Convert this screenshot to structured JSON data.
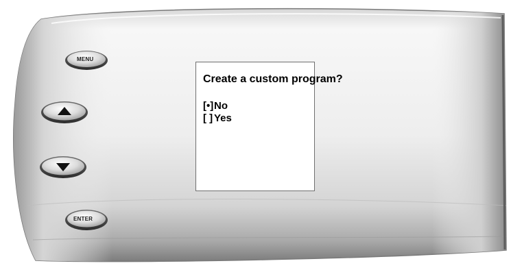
{
  "device": {
    "buttons": {
      "menu_label": "MENU",
      "enter_label": "ENTER",
      "up_icon": "triangle-up-icon",
      "down_icon": "triangle-down-icon"
    },
    "colors": {
      "body_light": "#f2f2f2",
      "body_mid": "#cfcfcf",
      "body_dark": "#8a8a8a",
      "screen_bg": "#ffffff",
      "screen_border": "#6f6f6f",
      "button_face": "#d9d9d9",
      "arrow": "#111111"
    }
  },
  "screen": {
    "title": "Create a custom program?",
    "options": [
      {
        "mark": "[•]",
        "label": "No",
        "selected": true
      },
      {
        "mark": "[ ]",
        "label": "Yes",
        "selected": false
      }
    ]
  }
}
